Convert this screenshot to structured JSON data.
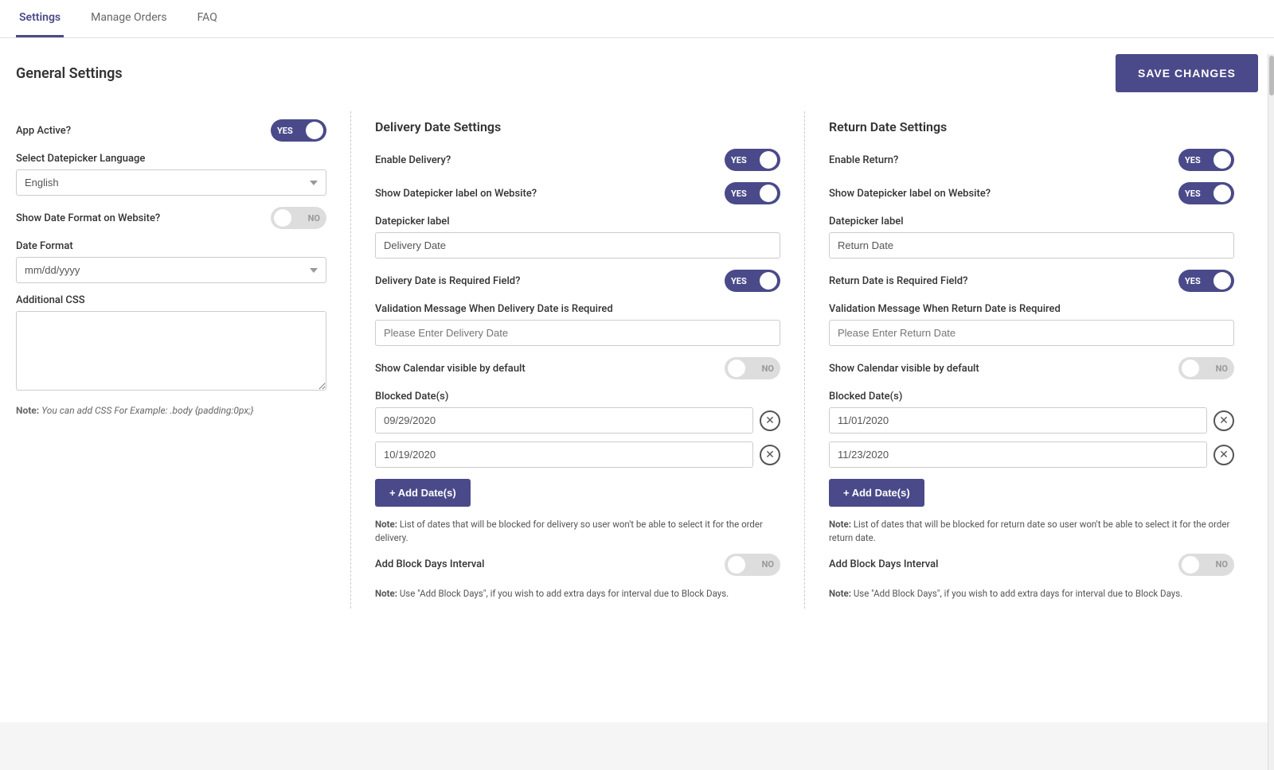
{
  "nav": {
    "tabs": [
      {
        "label": "Settings",
        "active": true
      },
      {
        "label": "Manage Orders",
        "active": false
      },
      {
        "label": "FAQ",
        "active": false
      }
    ]
  },
  "header": {
    "title": "General Settings",
    "save_button": "SAVE CHANGES"
  },
  "general": {
    "app_active_label": "App Active?",
    "app_active_state": "YES",
    "app_active_on": true,
    "select_language_label": "Select Datepicker Language",
    "language_value": "English",
    "show_date_format_label": "Show Date Format on Website?",
    "show_date_format_on": false,
    "show_date_format_state": "NO",
    "date_format_label": "Date Format",
    "date_format_value": "mm/dd/yyyy",
    "additional_css_label": "Additional CSS",
    "additional_css_value": "",
    "note_label": "Note:",
    "note_text": "You can add CSS For Example: .body {padding:0px;}"
  },
  "delivery": {
    "section_title": "Delivery Date Settings",
    "enable_delivery_label": "Enable Delivery?",
    "enable_delivery_on": true,
    "enable_delivery_state": "YES",
    "show_datepicker_label_label": "Show Datepicker label on Website?",
    "show_datepicker_label_on": true,
    "show_datepicker_label_state": "YES",
    "datepicker_label_heading": "Datepicker label",
    "datepicker_label_value": "Delivery Date",
    "required_field_label": "Delivery Date is Required Field?",
    "required_field_on": true,
    "required_field_state": "YES",
    "validation_msg_label": "Validation Message When Delivery Date is Required",
    "validation_msg_placeholder": "Please Enter Delivery Date",
    "show_calendar_label": "Show Calendar visible by default",
    "show_calendar_on": false,
    "show_calendar_state": "NO",
    "blocked_dates_label": "Blocked Date(s)",
    "blocked_dates": [
      "09/29/2020",
      "10/19/2020"
    ],
    "add_date_btn": "+ Add Date(s)",
    "note_label": "Note:",
    "note_text": "List of dates that will be blocked for delivery so user won't be able to select it for the order delivery.",
    "block_days_interval_label": "Add Block Days Interval",
    "block_days_interval_on": false,
    "block_days_interval_state": "NO",
    "block_days_note_label": "Note:",
    "block_days_note_text": "Use \"Add Block Days\", if you wish to add extra days for interval due to Block Days."
  },
  "return": {
    "section_title": "Return Date Settings",
    "enable_return_label": "Enable Return?",
    "enable_return_on": true,
    "enable_return_state": "YES",
    "show_datepicker_label_label": "Show Datepicker label on Website?",
    "show_datepicker_label_on": true,
    "show_datepicker_label_state": "YES",
    "datepicker_label_heading": "Datepicker label",
    "datepicker_label_value": "Return Date",
    "required_field_label": "Return Date is Required Field?",
    "required_field_on": true,
    "required_field_state": "YES",
    "validation_msg_label": "Validation Message When Return Date is Required",
    "validation_msg_placeholder": "Please Enter Return Date",
    "show_calendar_label": "Show Calendar visible by default",
    "show_calendar_on": false,
    "show_calendar_state": "NO",
    "blocked_dates_label": "Blocked Date(s)",
    "blocked_dates": [
      "11/01/2020",
      "11/23/2020"
    ],
    "add_date_btn": "+ Add Date(s)",
    "note_label": "Note:",
    "note_text": "List of dates that will be blocked for return date so user won't be able to select it for the order return date.",
    "block_days_interval_label": "Add Block Days Interval",
    "block_days_interval_on": false,
    "block_days_interval_state": "NO",
    "block_days_note_label": "Note:",
    "block_days_note_text": "Use \"Add Block Days\", if you wish to add extra days for interval due to Block Days."
  }
}
